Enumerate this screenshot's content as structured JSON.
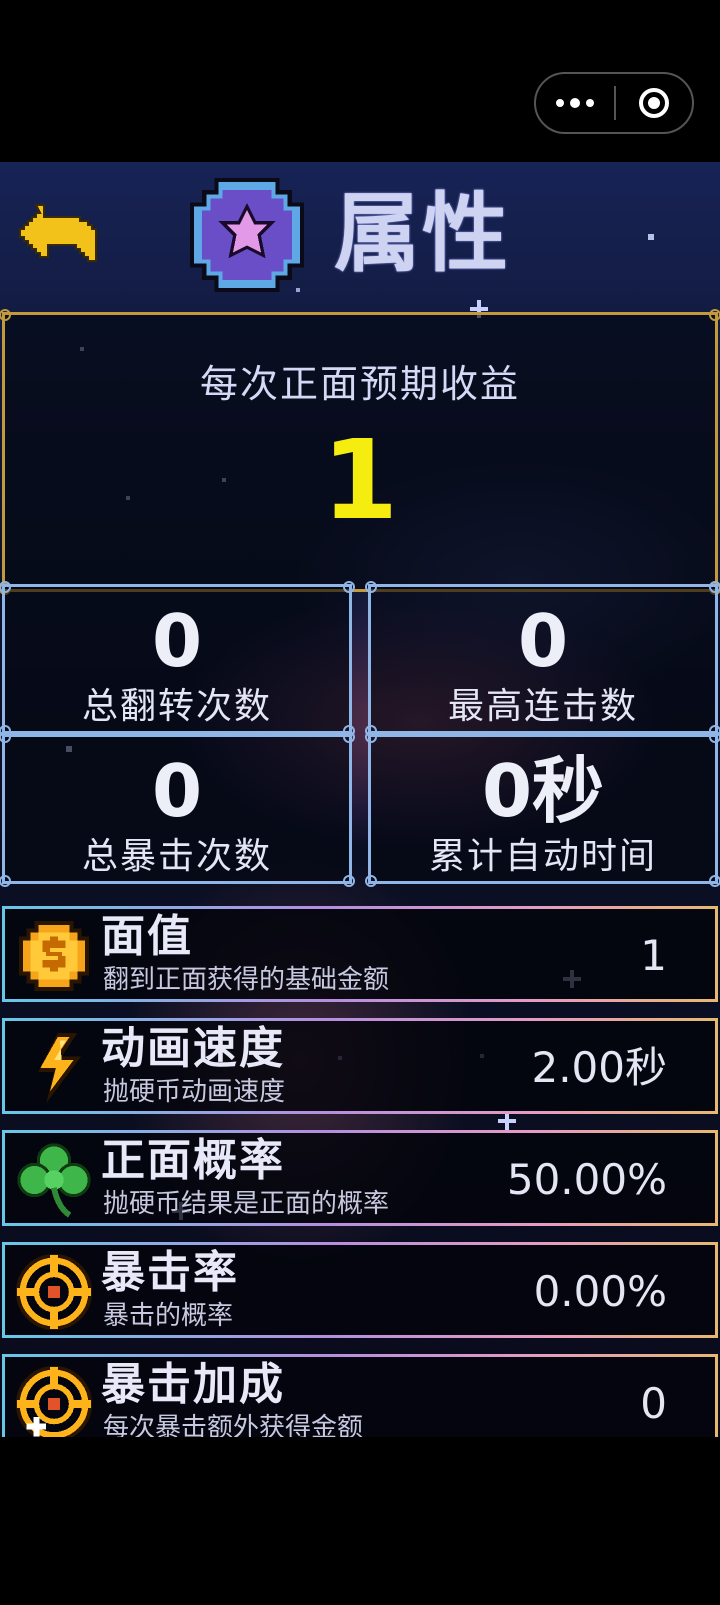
{
  "header": {
    "title": "属性",
    "back_icon": "back-arrow-icon",
    "badge_icon": "star-badge-icon"
  },
  "summary": {
    "label": "每次正面预期收益",
    "value": "1"
  },
  "stats": [
    {
      "value": "0",
      "label": "总翻转次数"
    },
    {
      "value": "0",
      "label": "最高连击数"
    },
    {
      "value": "0",
      "label": "总暴击次数"
    },
    {
      "value": "0秒",
      "label": "累计自动时间"
    }
  ],
  "upgrades": [
    {
      "icon": "gold-coin-icon",
      "name": "面值",
      "desc": "翻到正面获得的基础金额",
      "value": "1"
    },
    {
      "icon": "lightning-icon",
      "name": "动画速度",
      "desc": "抛硬币动画速度",
      "value": "2.00秒"
    },
    {
      "icon": "clover-icon",
      "name": "正面概率",
      "desc": "抛硬币结果是正面的概率",
      "value": "50.00%"
    },
    {
      "icon": "crosshair-icon",
      "name": "暴击率",
      "desc": "暴击的概率",
      "value": "0.00%"
    },
    {
      "icon": "crosshair-plus-icon",
      "name": "暴击加成",
      "desc": "每次暴击额外获得金额",
      "value": "0"
    }
  ],
  "colors": {
    "accent_yellow": "#f5ec10",
    "income_border": "#c29a3a",
    "stat_border": "#8fb6e6"
  }
}
